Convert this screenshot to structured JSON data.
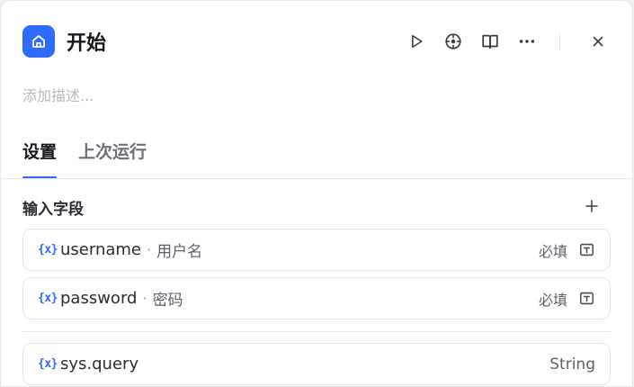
{
  "header": {
    "title": "开始",
    "description_placeholder": "添加描述..."
  },
  "icons": {
    "node": "home-icon",
    "run": "play-icon",
    "locate": "crosshair-icon",
    "docs": "book-icon",
    "more": "more-dots-icon",
    "close": "close-icon"
  },
  "tabs": [
    {
      "label": "设置",
      "active": true
    },
    {
      "label": "上次运行",
      "active": false
    }
  ],
  "section": {
    "title": "输入字段"
  },
  "fields": [
    {
      "var": "{x}",
      "name": "username",
      "sep": "·",
      "label": "用户名",
      "required": "必填"
    },
    {
      "var": "{x}",
      "name": "password",
      "sep": "·",
      "label": "密码",
      "required": "必填"
    }
  ],
  "system_fields": [
    {
      "var": "{x}",
      "name": "sys.query",
      "type": "String"
    }
  ],
  "colors": {
    "accent": "#2f6bff",
    "text": "#15171c",
    "muted": "#b6b8bf"
  }
}
